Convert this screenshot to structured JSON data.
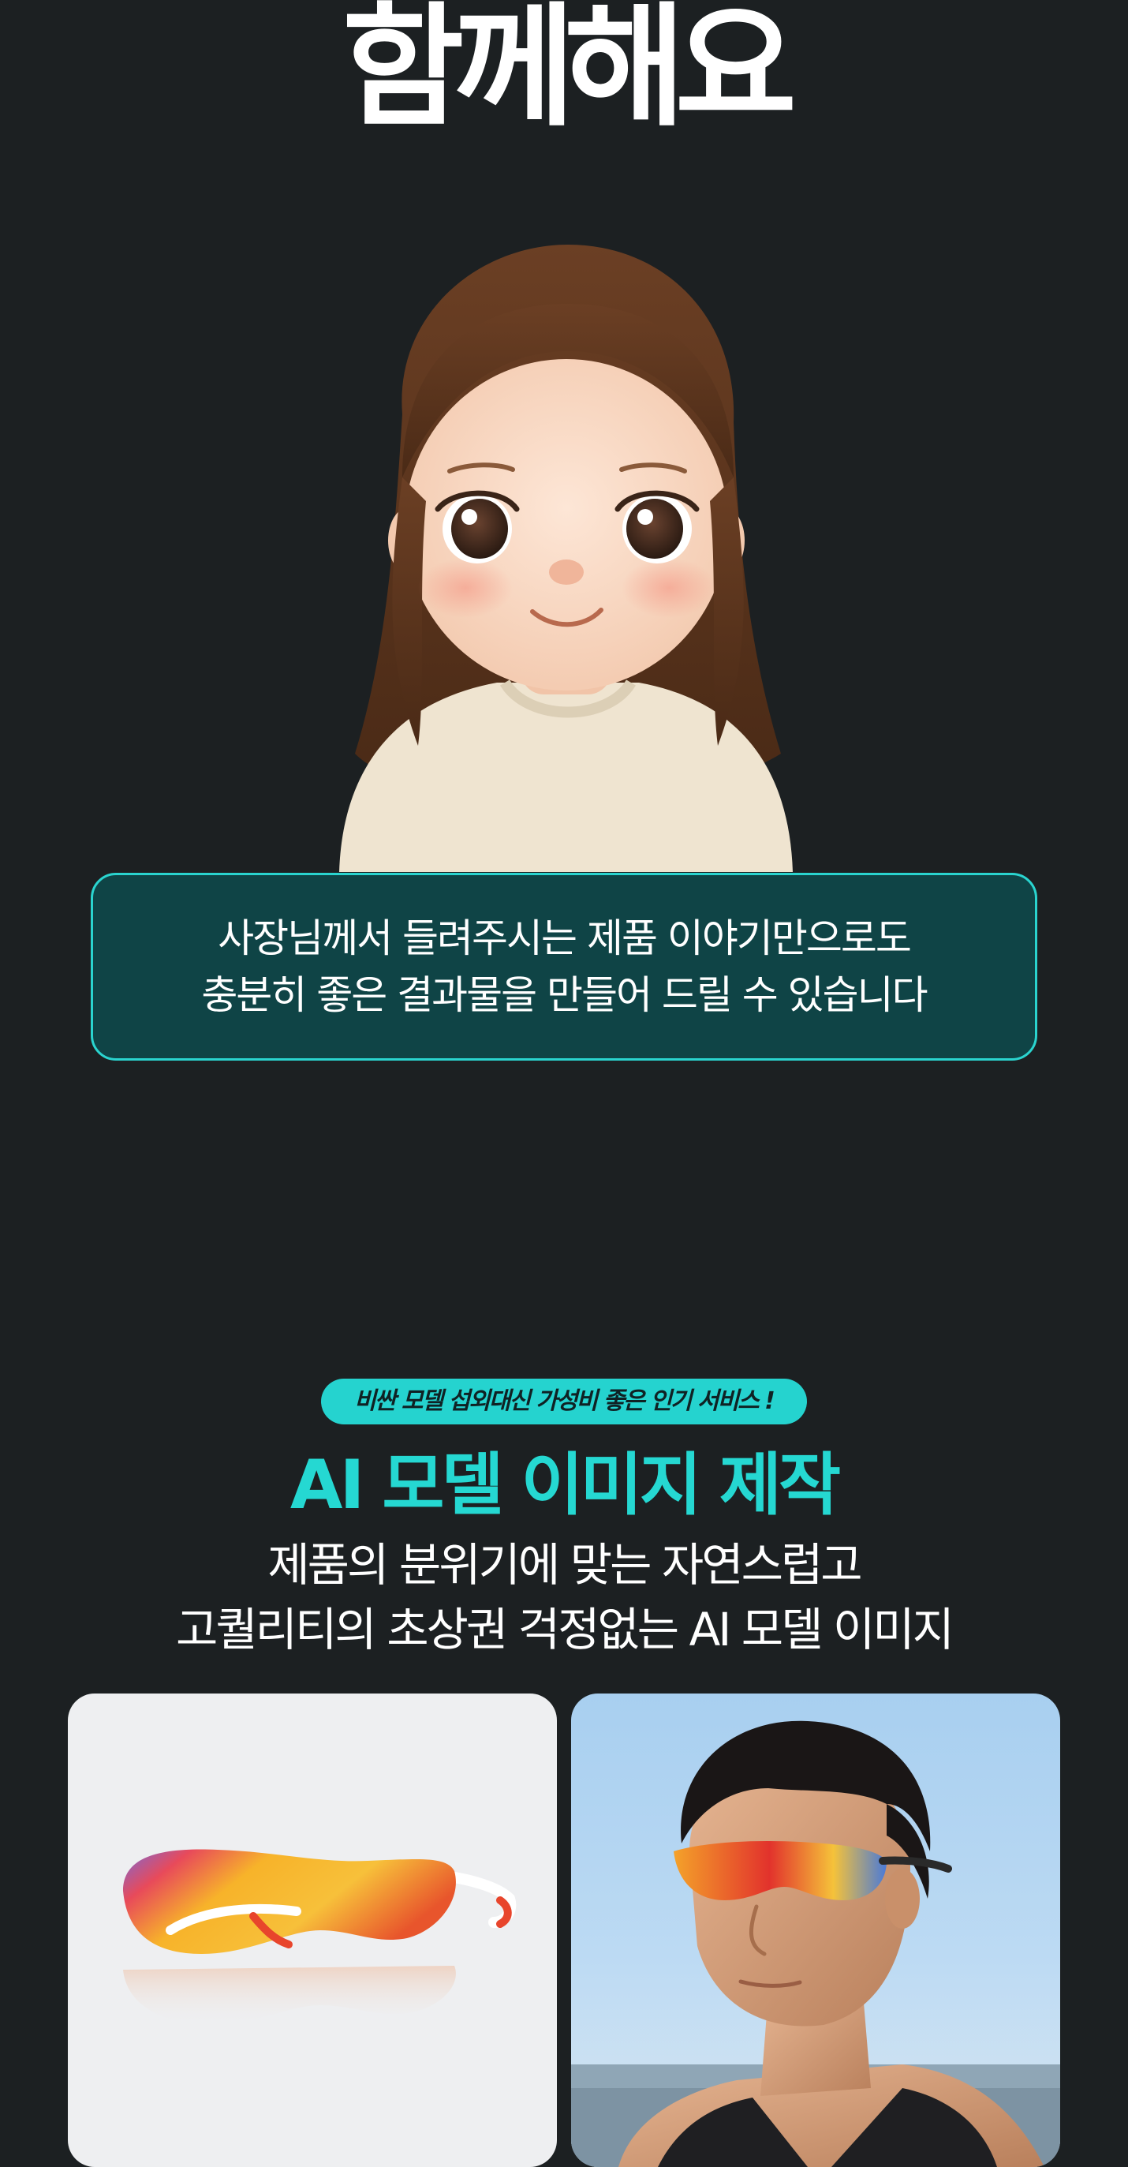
{
  "hero": {
    "title": "함께해요"
  },
  "bubble": {
    "line1": "사장님께서 들려주시는 제품 이야기만으로도",
    "line2": "충분히 좋은 결과물을 만들어 드릴 수 있습니다"
  },
  "section": {
    "badge": "비싼 모델 섭외대신 가성비 좋은 인기 서비스 !",
    "title": "AI 모델 이미지 제작",
    "subtitle_line1": "제품의 분위기에 맞는 자연스럽고",
    "subtitle_line2": "고퀄리티의 초상권 걱정없는 AI 모델 이미지"
  },
  "colors": {
    "background": "#1c2022",
    "accent": "#25d3cf",
    "bubble_fill": "#0f4446"
  },
  "images": {
    "character": "girl-character-illustration",
    "product": "sport-sunglasses-product-photo",
    "model": "ai-model-wearing-sunglasses-photo"
  }
}
